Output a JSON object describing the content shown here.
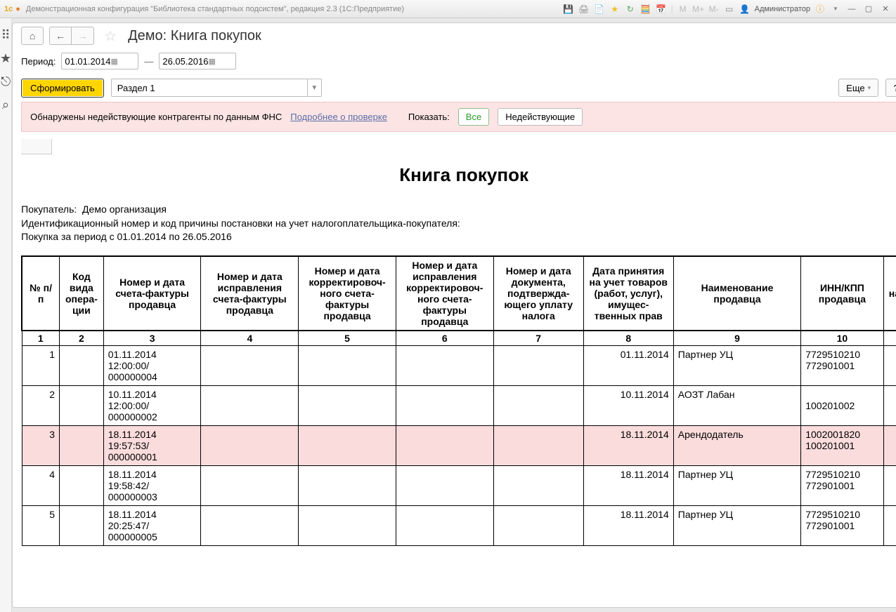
{
  "titlebar": {
    "text": "Демонстрационная конфигурация \"Библиотека стандартных подсистем\", редакция 2.3  (1С:Предприятие)",
    "user": "Администратор",
    "m": "M",
    "mplus": "M+",
    "mminus": "M-"
  },
  "page": {
    "title": "Демо: Книга покупок"
  },
  "period": {
    "label": "Период:",
    "from": "01.01.2014",
    "to": "26.05.2016"
  },
  "actions": {
    "form": "Сформировать",
    "section": "Раздел 1",
    "more": "Еще",
    "help": "?"
  },
  "alert": {
    "text": "Обнаружены недействующие контрагенты по данным ФНС",
    "link": "Подробнее о проверке",
    "show_label": "Показать:",
    "all": "Все",
    "invalid": "Недействующие"
  },
  "report": {
    "title": "Книга покупок",
    "buyer_label": "Покупатель:",
    "buyer": "Демо организация",
    "tax_id_label": "Идентификационный номер и код причины постановки на учет налогоплательщика-покупателя:",
    "period_line": "Покупка за период с 01.01.2014 по 26.05.2016",
    "headers": {
      "h1": "№ п/п",
      "h2": "Код вида опера-ции",
      "h3": "Номер и дата счета-фактуры продавца",
      "h4": "Номер и дата исправления счета-фактуры продавца",
      "h5": "Номер и дата корректировоч-ного счета-фактуры продавца",
      "h6": "Номер и дата исправления корректировоч-ного счета-фактуры продавца",
      "h7": "Номер и дата документа, подтвержда-ющего уплату налога",
      "h8": "Дата принятия на учет  товаров (работ, услуг), имущес-твенных прав",
      "h9": "Наименование продавца",
      "h10": "ИНН/КПП продавца",
      "h11": "на"
    },
    "nums": {
      "n1": "1",
      "n2": "2",
      "n3": "3",
      "n4": "4",
      "n5": "5",
      "n6": "6",
      "n7": "7",
      "n8": "8",
      "n9": "9",
      "n10": "10"
    },
    "rows": [
      {
        "n": "1",
        "invoice": "01.11.2014 12:00:00/000000004",
        "date": "01.11.2014",
        "seller": "Партнер УЦ",
        "inn": "7729510210 772901001",
        "hl": false
      },
      {
        "n": "2",
        "invoice": "10.11.2014 12:00:00/000000002",
        "date": "10.11.2014",
        "seller": "АОЗТ Лабан",
        "inn": "\n100201002",
        "hl": false
      },
      {
        "n": "3",
        "invoice": "18.11.2014 19:57:53/000000001",
        "date": "18.11.2014",
        "seller": "Арендодатель",
        "inn": "1002001820 100201001",
        "hl": true
      },
      {
        "n": "4",
        "invoice": "18.11.2014 19:58:42/000000003",
        "date": "18.11.2014",
        "seller": "Партнер УЦ",
        "inn": "7729510210 772901001",
        "hl": false
      },
      {
        "n": "5",
        "invoice": "18.11.2014 20:25:47/000000005",
        "date": "18.11.2014",
        "seller": "Партнер УЦ",
        "inn": "7729510210 772901001",
        "hl": false
      }
    ]
  }
}
